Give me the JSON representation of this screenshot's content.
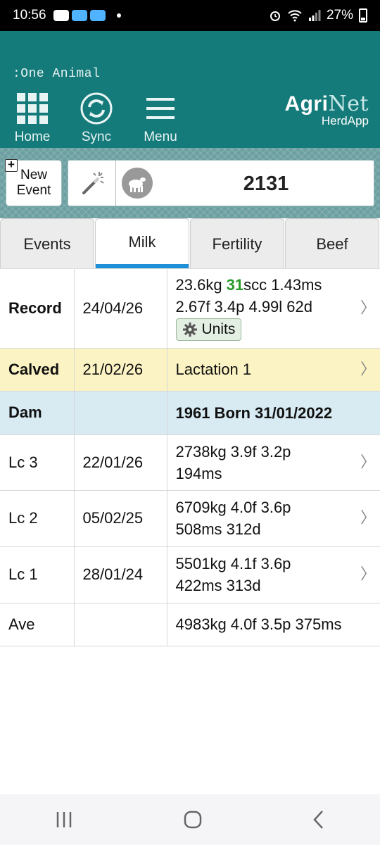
{
  "status_bar": {
    "time": "10:56",
    "battery": "27%"
  },
  "header": {
    "breadcrumb": ":One Animal",
    "nav": {
      "home": "Home",
      "sync": "Sync",
      "menu": "Menu"
    },
    "brand": {
      "agri": "Agri",
      "net": "Net",
      "sub": "HerdApp"
    }
  },
  "toolbar": {
    "new_event_line1": "New",
    "new_event_line2": "Event",
    "animal_id": "2131"
  },
  "tabs": [
    "Events",
    "Milk",
    "Fertility",
    "Beef"
  ],
  "active_tab": "Milk",
  "rows": {
    "record": {
      "label": "Record",
      "date": "24/04/26",
      "line1_pre": "23.6kg ",
      "line1_scc": "31",
      "line1_post": "scc 1.43ms",
      "line2": "2.67f 3.4p 4.99l 62d",
      "units": "Units"
    },
    "calved": {
      "label": "Calved",
      "date": "21/02/26",
      "info": "Lactation 1"
    },
    "dam": {
      "label": "Dam",
      "date": "",
      "info": "1961 Born 31/01/2022"
    },
    "lc3": {
      "label": "Lc 3",
      "date": "22/01/26",
      "line1": "2738kg 3.9f 3.2p",
      "line2": "194ms"
    },
    "lc2": {
      "label": "Lc 2",
      "date": "05/02/25",
      "line1": "6709kg 4.0f 3.6p",
      "line2": "508ms 312d"
    },
    "lc1": {
      "label": "Lc 1",
      "date": "28/01/24",
      "line1": "5501kg 4.1f 3.6p",
      "line2": "422ms 313d"
    },
    "ave": {
      "label": "Ave",
      "date": "",
      "info": "4983kg 4.0f 3.5p 375ms"
    }
  },
  "colors": {
    "header": "#157a7a",
    "calved_row": "#fbf3c3",
    "dam_row": "#d8ebf3",
    "active_tab_underline": "#1f8fd8",
    "scc_highlight": "#2a9a2a"
  }
}
